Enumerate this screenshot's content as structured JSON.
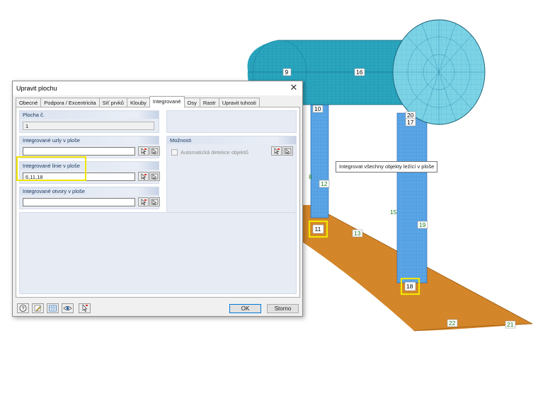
{
  "dialog": {
    "title": "Upravit plochu",
    "close_label": "✕",
    "tabs": [
      {
        "label": "Obecné"
      },
      {
        "label": "Podpora / Excentricita"
      },
      {
        "label": "Síť prvků"
      },
      {
        "label": "Klouby"
      },
      {
        "label": "Integrované"
      },
      {
        "label": "Osy"
      },
      {
        "label": "Rastr"
      },
      {
        "label": "Upravit tuhosti"
      }
    ],
    "active_tab": "Integrované",
    "surface_no": {
      "label": "Plocha č.",
      "value": "1"
    },
    "integrated_nodes": {
      "label": "Integrované uzly v ploše",
      "value": ""
    },
    "integrated_lines": {
      "label": "Integrované linie v ploše",
      "value": "6,11,18"
    },
    "integrated_openings": {
      "label": "Integrované otvory v ploše",
      "value": ""
    },
    "options": {
      "label": "Možnosti",
      "auto_detect_label": "Automatická detekce objektů",
      "auto_detect_checked": false
    },
    "buttons": {
      "ok": "OK",
      "cancel": "Storno"
    },
    "icons": {
      "pick": "pick-cursor-icon",
      "pick_all": "pick-all-icon",
      "help": "help-icon",
      "edit": "edit-icon",
      "table": "table-icon",
      "view": "eye-icon",
      "select": "select-icon"
    }
  },
  "tooltip": "Integrovat všechny objekty ležící v ploše",
  "model_labels": {
    "l9": "9",
    "l16": "16",
    "l10": "10",
    "l20": "20",
    "l17": "17",
    "l8": "8",
    "l12": "12",
    "l15": "15",
    "l11": "11",
    "l13": "13",
    "l19": "19",
    "l18": "18",
    "l22": "22",
    "l21": "21"
  },
  "colors": {
    "tank_shell": "#2aa6bf",
    "tank_end": "#7cd3e6",
    "wall": "#5ca6e6",
    "slab": "#d88a2c",
    "highlight": "#f2e600"
  }
}
